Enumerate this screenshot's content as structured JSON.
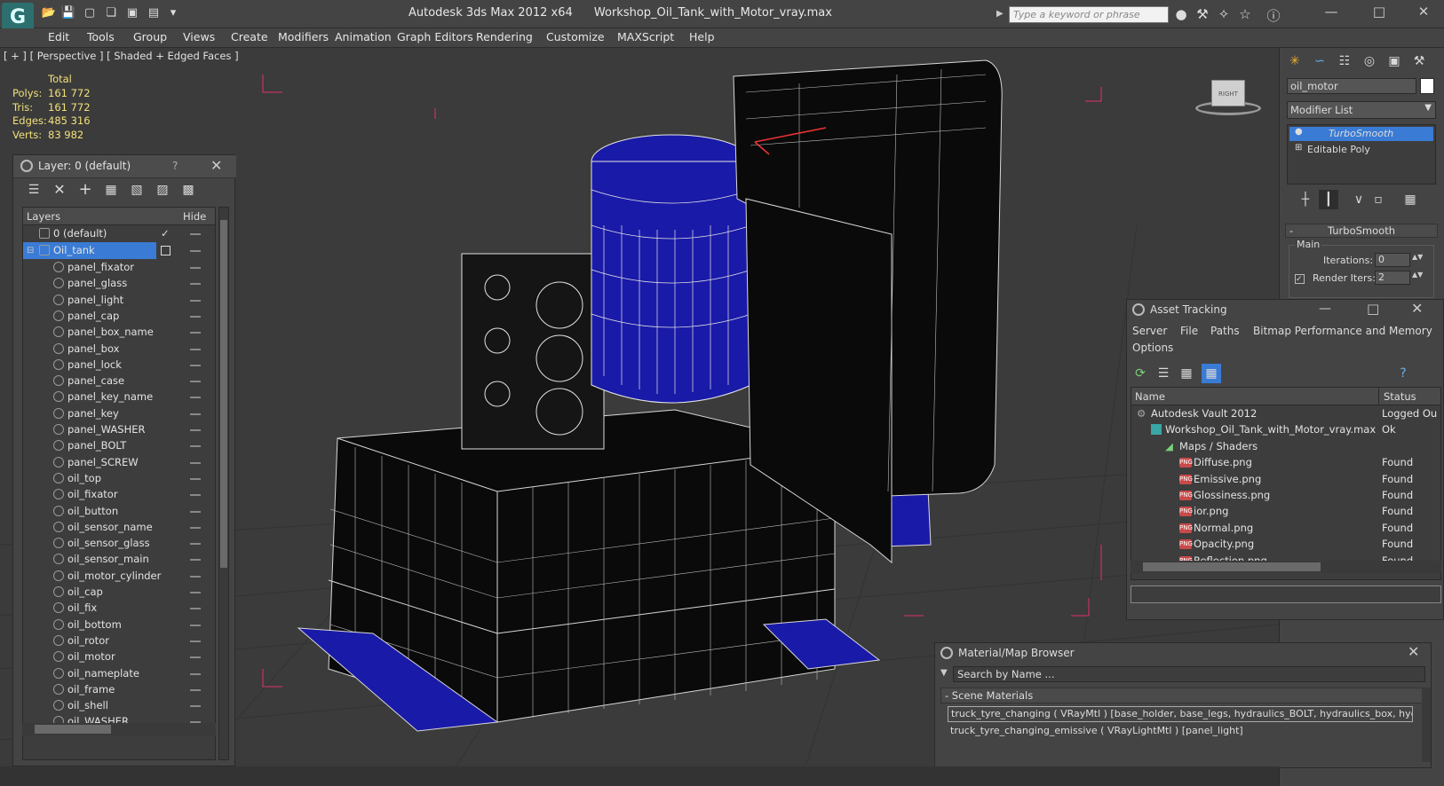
{
  "titlebar": {
    "logo": "G",
    "app_title": "Autodesk 3ds Max  2012 x64",
    "file_title": "Workshop_Oil_Tank_with_Motor_vray.max",
    "search_placeholder": "Type a keyword or phrase"
  },
  "menu": [
    "Edit",
    "Tools",
    "Group",
    "Views",
    "Create",
    "Modifiers",
    "Animation",
    "Graph Editors",
    "Rendering",
    "Customize",
    "MAXScript",
    "Help"
  ],
  "viewport": {
    "label": "[ + ] [ Perspective ] [ Shaded + Edged Faces ]",
    "stats": {
      "header": "Total",
      "rows": [
        {
          "label": "Polys:",
          "value": "161 772"
        },
        {
          "label": "Tris:",
          "value": "161 772"
        },
        {
          "label": "Edges:",
          "value": "485 316"
        },
        {
          "label": "Verts:",
          "value": "83 982"
        }
      ]
    },
    "viewcube_label": "RIGHT"
  },
  "layers": {
    "title": "Layer: 0 (default)",
    "help": "?",
    "col_layers": "Layers",
    "col_hide": "Hide",
    "default_layer": "0 (default)",
    "active_layer": "Oil_tank",
    "items": [
      "panel_fixator",
      "panel_glass",
      "panel_light",
      "panel_cap",
      "panel_box_name",
      "panel_box",
      "panel_lock",
      "panel_case",
      "panel_key_name",
      "panel_key",
      "panel_WASHER",
      "panel_BOLT",
      "panel_SCREW",
      "oil_top",
      "oil_fixator",
      "oil_button",
      "oil_sensor_name",
      "oil_sensor_glass",
      "oil_sensor_main",
      "oil_motor_cylinder",
      "oil_cap",
      "oil_fix",
      "oil_bottom",
      "oil_rotor",
      "oil_motor",
      "oil_nameplate",
      "oil_frame",
      "oil_shell",
      "oil_WASHER"
    ]
  },
  "command_panel": {
    "object_name": "oil_motor",
    "modifier_list": "Modifier List",
    "stack": [
      "TurboSmooth",
      "Editable Poly"
    ],
    "rollout_title": "TurboSmooth",
    "group_main": "Main",
    "iterations_label": "Iterations:",
    "iterations_value": "0",
    "render_iters_label": "Render Iters:",
    "render_iters_value": "2"
  },
  "asset_tracking": {
    "title": "Asset Tracking",
    "menu": [
      "Server",
      "File",
      "Paths",
      "Bitmap Performance and Memory",
      "Options"
    ],
    "col_name": "Name",
    "col_status": "Status",
    "rows": [
      {
        "name": "Autodesk Vault 2012",
        "status": "Logged Ou",
        "indent": 0,
        "kind": "vault"
      },
      {
        "name": "Workshop_Oil_Tank_with_Motor_vray.max",
        "status": "Ok",
        "indent": 1,
        "kind": "max"
      },
      {
        "name": "Maps / Shaders",
        "status": "",
        "indent": 2,
        "kind": "maps"
      },
      {
        "name": "Diffuse.png",
        "status": "Found",
        "indent": 3,
        "kind": "png"
      },
      {
        "name": "Emissive.png",
        "status": "Found",
        "indent": 3,
        "kind": "png"
      },
      {
        "name": "Glossiness.png",
        "status": "Found",
        "indent": 3,
        "kind": "png"
      },
      {
        "name": "ior.png",
        "status": "Found",
        "indent": 3,
        "kind": "png"
      },
      {
        "name": "Normal.png",
        "status": "Found",
        "indent": 3,
        "kind": "png"
      },
      {
        "name": "Opacity.png",
        "status": "Found",
        "indent": 3,
        "kind": "png"
      },
      {
        "name": "Reflection.png",
        "status": "Found",
        "indent": 3,
        "kind": "png"
      }
    ]
  },
  "material_browser": {
    "title": "Material/Map Browser",
    "search_placeholder": "Search by Name ...",
    "group": "- Scene Materials",
    "items": [
      "truck_tyre_changing ( VRayMtl ) [base_holder, base_legs, hydraulics_BOLT, hydraulics_box, hydraul...",
      "truck_tyre_changing_emissive ( VRayLightMtl ) [panel_light]"
    ]
  },
  "colors": {
    "wire": "#d8d8d8",
    "selection_blue": "#1a1aa8",
    "accent_highlight": "#3a7bd5",
    "stat_yellow": "#f3e07a",
    "bbox_pink": "#e0306a"
  }
}
